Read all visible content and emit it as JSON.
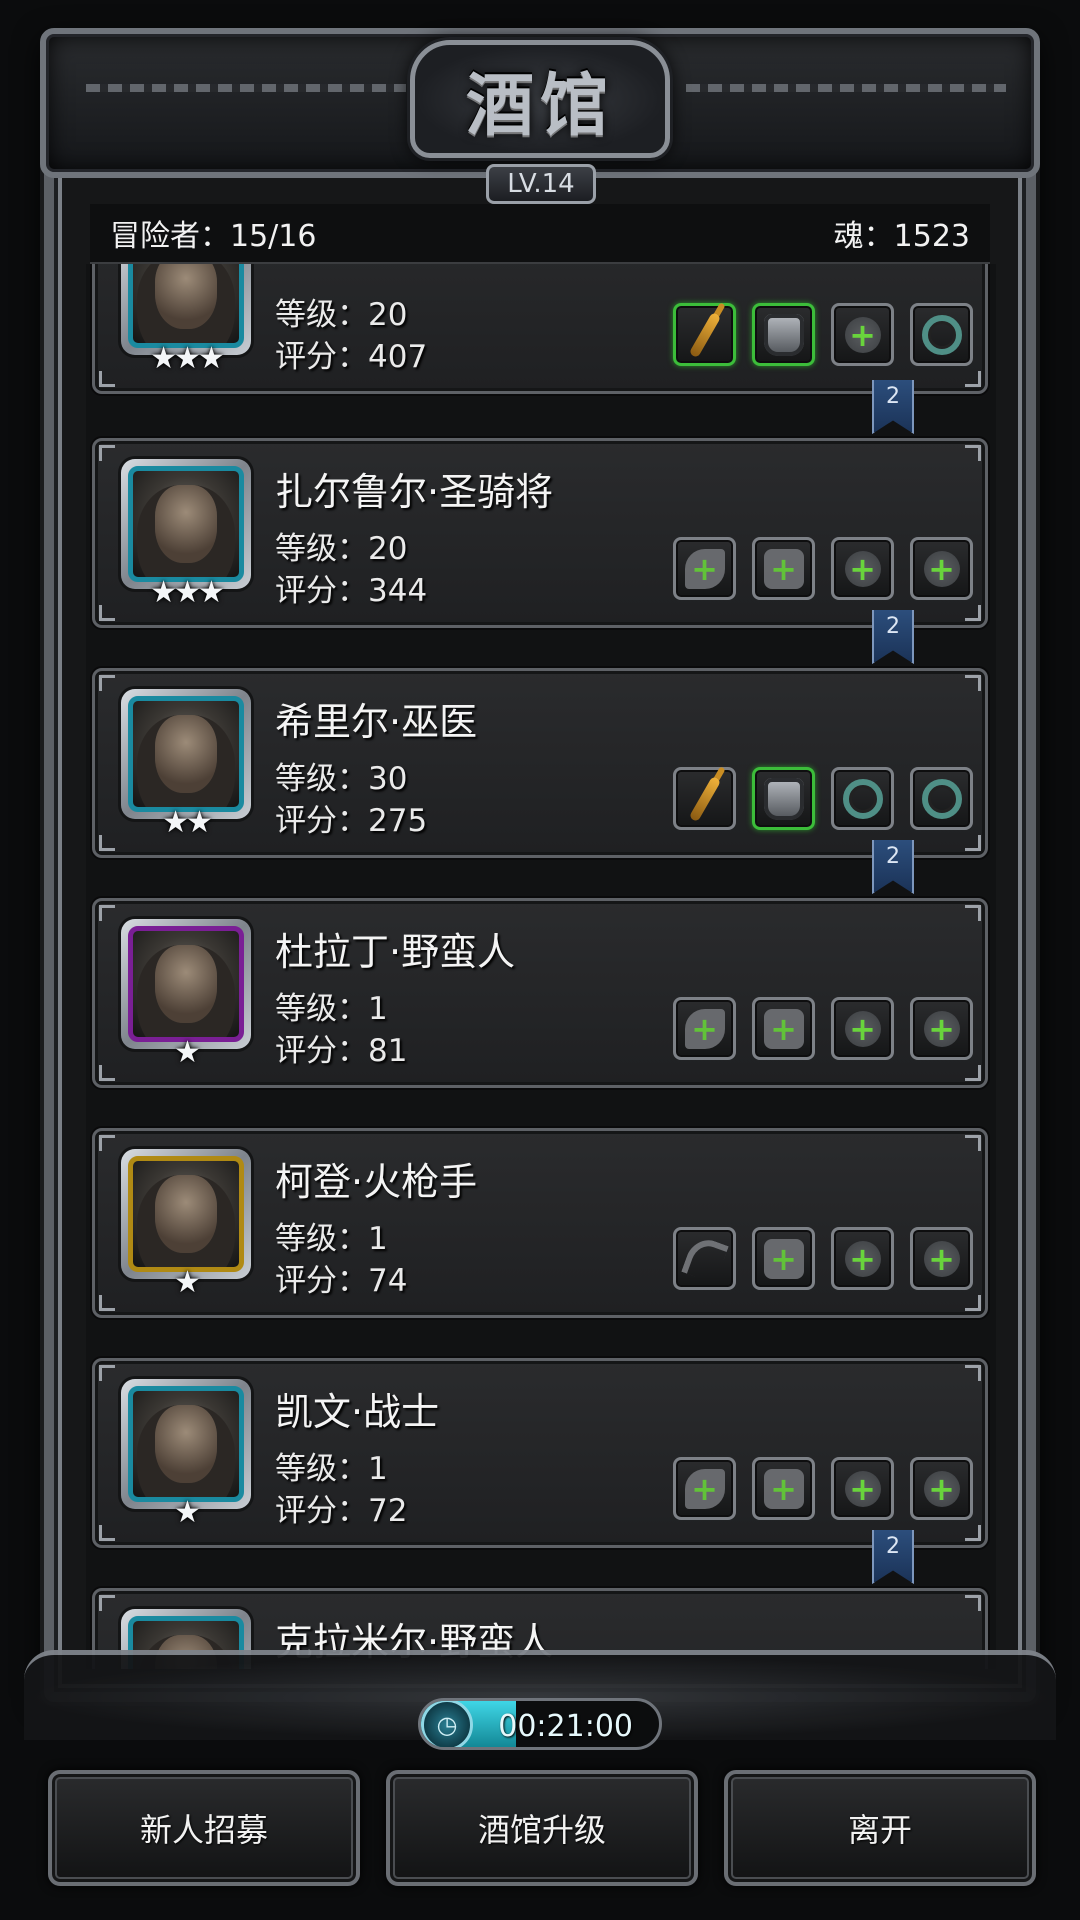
{
  "title": "酒馆",
  "level": "LV.14",
  "adventurers_label": "冒险者：15/16",
  "souls_label": "魂：1523",
  "timer": {
    "text": "00:21:00",
    "fill_percent": 40
  },
  "buttons": {
    "recruit": "新人招募",
    "upgrade": "酒馆升级",
    "leave": "离开"
  },
  "heroes": [
    {
      "name": "",
      "level": "等级：20",
      "score": "评分：407",
      "stars": "★★★",
      "frame": "#1a8aa0",
      "slots": [
        "staff-green",
        "armor-green",
        "plus",
        "ring"
      ],
      "ribbon": "2"
    },
    {
      "name": "扎尔鲁尔·圣骑将",
      "level": "等级：20",
      "score": "评分：344",
      "stars": "★★★",
      "frame": "#1a8aa0",
      "slots": [
        "weapon-empty",
        "armor-empty",
        "plus",
        "plus"
      ],
      "ribbon": "2"
    },
    {
      "name": "希里尔·巫医",
      "level": "等级：30",
      "score": "评分：275",
      "stars": "★★",
      "frame": "#1a8aa0",
      "slots": [
        "staff",
        "armor-green",
        "ring",
        "ring"
      ],
      "ribbon": "2"
    },
    {
      "name": "杜拉丁·野蛮人",
      "level": "等级：1",
      "score": "评分：81",
      "stars": "★",
      "frame": "#7a1f95",
      "slots": [
        "weapon-empty",
        "armor-empty",
        "plus",
        "plus"
      ],
      "ribbon": ""
    },
    {
      "name": "柯登·火枪手",
      "level": "等级：1",
      "score": "评分：74",
      "stars": "★",
      "frame": "#b08a14",
      "slots": [
        "scythe",
        "armor-empty",
        "plus",
        "plus"
      ],
      "ribbon": ""
    },
    {
      "name": "凯文·战士",
      "level": "等级：1",
      "score": "评分：72",
      "stars": "★",
      "frame": "#1a8aa0",
      "slots": [
        "weapon-empty",
        "armor-empty",
        "plus",
        "plus"
      ],
      "ribbon": "2"
    },
    {
      "name": "克拉米尔·野蛮人",
      "level": "",
      "score": "",
      "stars": "",
      "frame": "#1a8aa0",
      "slots": [],
      "ribbon": ""
    }
  ]
}
